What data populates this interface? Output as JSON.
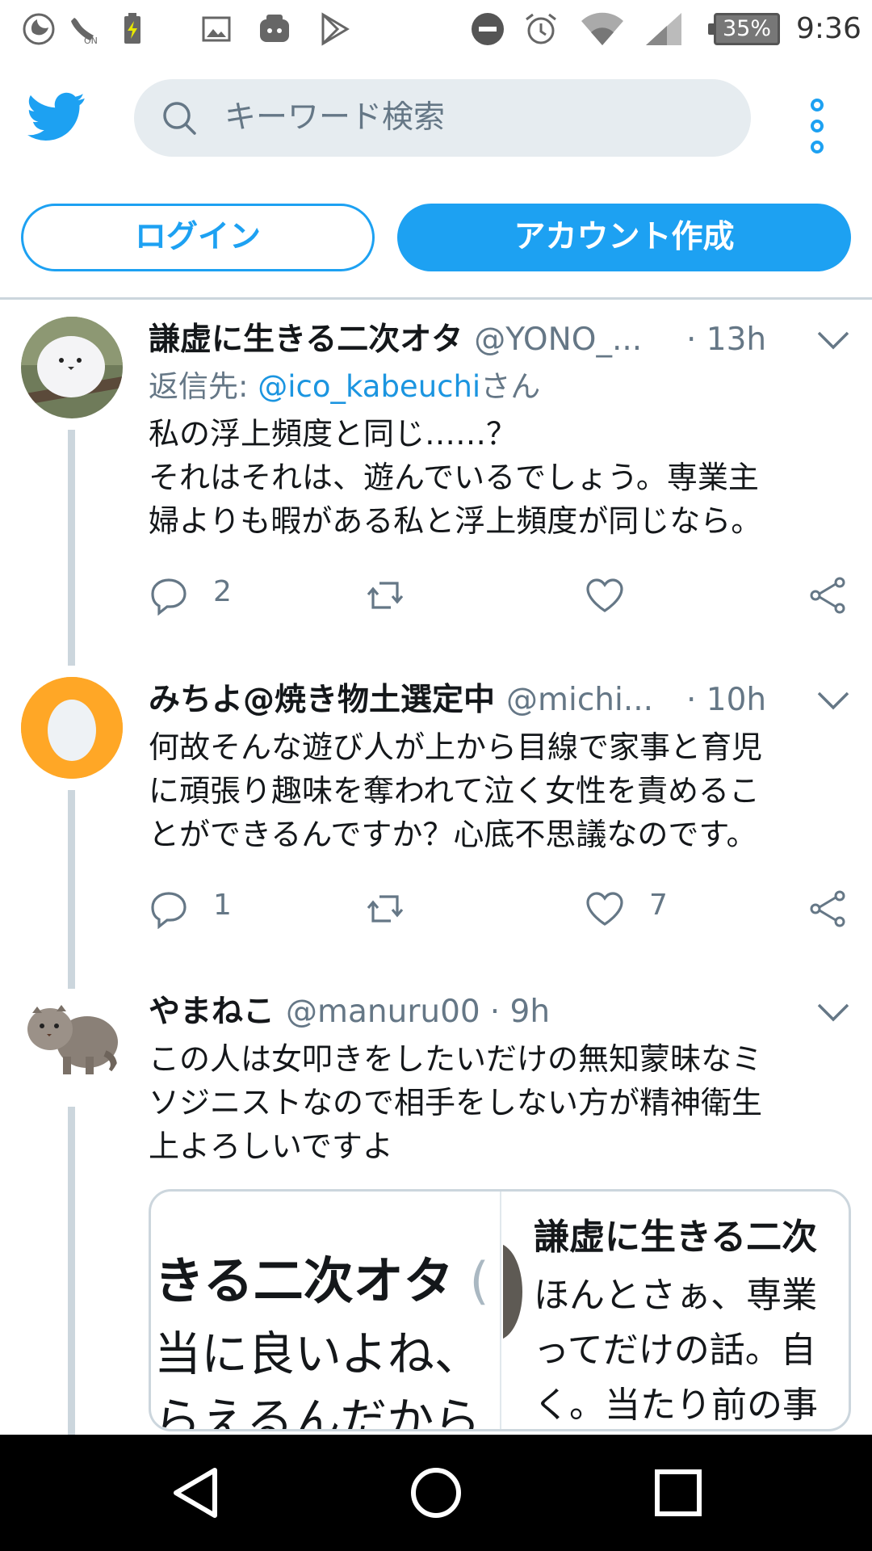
{
  "status_bar": {
    "battery_percent": "35%",
    "time": "9:36"
  },
  "header": {
    "search_placeholder": "キーワード検索",
    "login_label": "ログイン",
    "signup_label": "アカウント作成",
    "accent_color": "#1da1f2"
  },
  "tweets": [
    {
      "name": "謙虚に生きる二次オタ",
      "handle": "@YONO_...",
      "time": "· 13h",
      "reply_prefix": "返信先: ",
      "reply_handle": "@ico_kabeuchi",
      "reply_suffix": "さん",
      "body": [
        "私の浮上頻度と同じ……？",
        "それはそれは、遊んでいるでしょう。専業主",
        "婦よりも暇がある私と浮上頻度が同じなら。"
      ],
      "replies": "2",
      "retweets": "",
      "likes": ""
    },
    {
      "name": "みちよ@焼き物土選定中",
      "handle": "@michi...",
      "time": "· 10h",
      "body": [
        "何故そんな遊び人が上から目線で家事と育児",
        "に頑張り趣味を奪われて泣く女性を責めるこ",
        "とができるんですか？心底不思議なのです。"
      ],
      "replies": "1",
      "retweets": "",
      "likes": "7"
    },
    {
      "name": "やまねこ",
      "handle": "@manuru00",
      "time": "· 9h",
      "body": [
        "この人は女叩きをしたいだけの無知蒙昧なミ",
        "ソジニストなので相手をしない方が精神衛生",
        "上よろしいですよ"
      ]
    }
  ],
  "quote": {
    "left_line1": "きる二次オタ",
    "left_line1_suffix": " (",
    "left_line2": "当に良いよね、",
    "left_line3": "らえるんだから",
    "right_line1": "謙虚に生きる二次",
    "right_line2": "ほんとさぁ、専業",
    "right_line3": "ってだけの話。自",
    "right_line4": "く。当たり前の事"
  },
  "icons": {
    "status_left": [
      "moon-icon",
      "volte-icon",
      "battery-charging-icon",
      "image-icon",
      "app-icon",
      "play-store-icon"
    ],
    "status_right": [
      "dnd-icon",
      "alarm-icon",
      "wifi-icon",
      "signal-icon"
    ],
    "actions": [
      "reply-icon",
      "retweet-icon",
      "like-icon",
      "share-icon"
    ],
    "nav": [
      "back-icon",
      "home-icon",
      "recents-icon"
    ]
  }
}
